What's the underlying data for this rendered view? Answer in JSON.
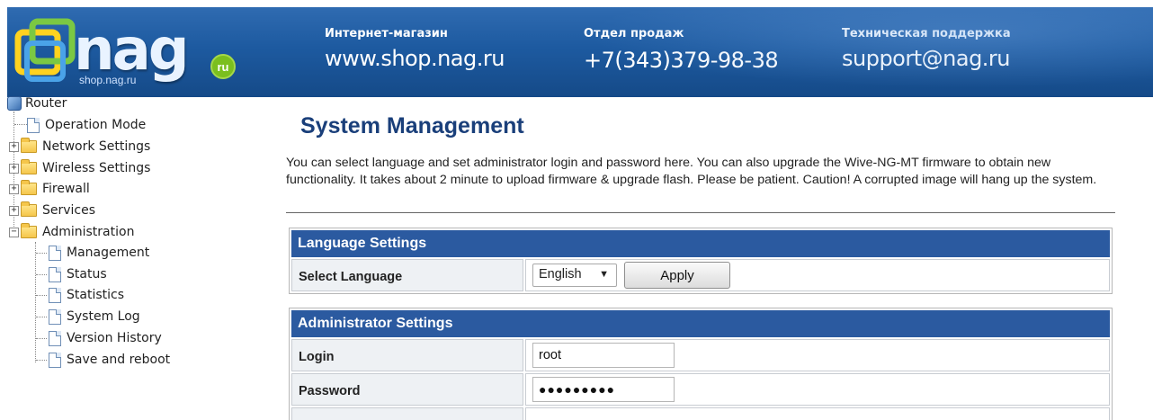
{
  "header": {
    "logo_text": "nag",
    "logo_sub": "shop.nag.ru",
    "logo_badge": "ru",
    "contacts": [
      {
        "label": "Интернет-магазин",
        "value": "www.shop.nag.ru"
      },
      {
        "label": "Отдел продаж",
        "value": "+7(343)379-98-38"
      },
      {
        "label": "Техническая поддержка",
        "value": "support@nag.ru"
      }
    ],
    "colors": {
      "banner": "#1d5aa0",
      "badge": "#7bbf1e"
    }
  },
  "tree": {
    "root": "Router",
    "items": [
      {
        "label": "Operation Mode",
        "type": "page"
      },
      {
        "label": "Network Settings",
        "type": "folder",
        "expander": "+"
      },
      {
        "label": "Wireless Settings",
        "type": "folder",
        "expander": "+"
      },
      {
        "label": "Firewall",
        "type": "folder",
        "expander": "+"
      },
      {
        "label": "Services",
        "type": "folder",
        "expander": "+"
      },
      {
        "label": "Administration",
        "type": "folder-open",
        "expander": "−"
      }
    ],
    "admin_children": [
      "Management",
      "Status",
      "Statistics",
      "System Log",
      "Version History",
      "Save and reboot"
    ]
  },
  "main": {
    "title": "System Management",
    "description": "You can select language and set administrator login and password here. You can also upgrade the Wive-NG-MT firmware to obtain new functionality. It takes about 2 minute to upload firmware & upgrade flash. Please be patient. Caution! A corrupted image will hang up the system.",
    "language": {
      "heading": "Language Settings",
      "label": "Select Language",
      "selected": "English",
      "apply": "Apply"
    },
    "admin": {
      "heading": "Administrator Settings",
      "login_label": "Login",
      "login_value": "root",
      "password_label": "Password",
      "password_value": "●●●●●●●●●"
    },
    "colors": {
      "section_head": "#2b5aa0",
      "title": "#1a3f7a"
    }
  }
}
